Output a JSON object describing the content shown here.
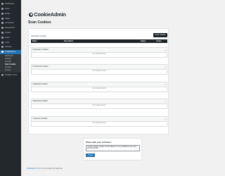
{
  "sidebar": {
    "items": [
      {
        "label": "Dashboard"
      },
      {
        "label": "Posts"
      },
      {
        "label": "Media"
      },
      {
        "label": "Pages"
      },
      {
        "label": "Comments"
      },
      {
        "label": "Appearance"
      },
      {
        "label": "Plugins"
      },
      {
        "label": "Users"
      },
      {
        "label": "Tools"
      },
      {
        "label": "Settings"
      },
      {
        "label": "CookieAdmin"
      }
    ],
    "submenu": [
      "Dashboard",
      "Settings",
      "Consent",
      "Scan Cookies",
      "Consent",
      "License"
    ],
    "collapse_label": "Collapse menu"
  },
  "brand": {
    "name": "CookieAdmin"
  },
  "page_title": "Scan Cookies",
  "card": {
    "label": "Scanned Cookies",
    "scan_button": "Scan Cookies",
    "columns": [
      "Name",
      "Description",
      "Expiry",
      "Action"
    ]
  },
  "groups": [
    {
      "title": "Necessary Cookies",
      "empty": "No Cookies Found"
    },
    {
      "title": "Functional Cookies",
      "empty": "No Cookies Found"
    },
    {
      "title": "Analytical Cookies",
      "empty": "No Cookies Found"
    },
    {
      "title": "Marketing Cookies",
      "empty": "No Cookies Found"
    },
    {
      "title": "Unknown Cookies",
      "empty": "No Cookies Found"
    }
  ],
  "share": {
    "title": "Share with your followers",
    "text": "I easily manage Cookie Consent Banner on my WordPress site using @CookieAdmin",
    "button": "Tweet"
  },
  "footer": {
    "prefix": "",
    "link": "CookieAdmin",
    "rest": " v1.0.1 You can report any bugs here"
  }
}
